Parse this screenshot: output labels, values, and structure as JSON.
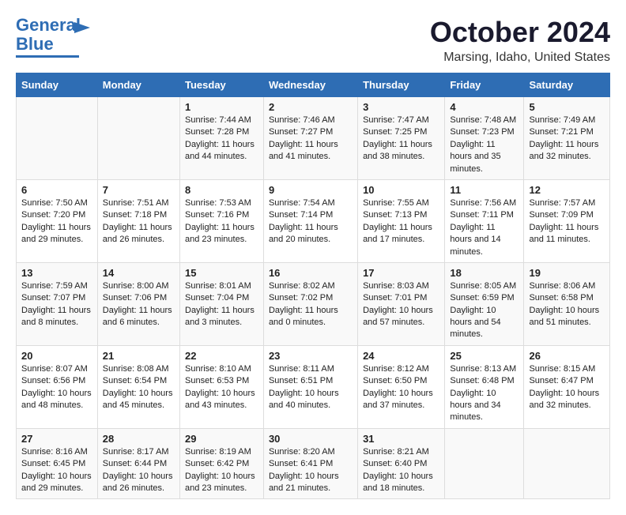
{
  "header": {
    "logo_line1": "General",
    "logo_line2": "Blue",
    "month": "October 2024",
    "location": "Marsing, Idaho, United States"
  },
  "weekdays": [
    "Sunday",
    "Monday",
    "Tuesday",
    "Wednesday",
    "Thursday",
    "Friday",
    "Saturday"
  ],
  "weeks": [
    [
      {
        "day": "",
        "sunrise": "",
        "sunset": "",
        "daylight": ""
      },
      {
        "day": "",
        "sunrise": "",
        "sunset": "",
        "daylight": ""
      },
      {
        "day": "1",
        "sunrise": "Sunrise: 7:44 AM",
        "sunset": "Sunset: 7:28 PM",
        "daylight": "Daylight: 11 hours and 44 minutes."
      },
      {
        "day": "2",
        "sunrise": "Sunrise: 7:46 AM",
        "sunset": "Sunset: 7:27 PM",
        "daylight": "Daylight: 11 hours and 41 minutes."
      },
      {
        "day": "3",
        "sunrise": "Sunrise: 7:47 AM",
        "sunset": "Sunset: 7:25 PM",
        "daylight": "Daylight: 11 hours and 38 minutes."
      },
      {
        "day": "4",
        "sunrise": "Sunrise: 7:48 AM",
        "sunset": "Sunset: 7:23 PM",
        "daylight": "Daylight: 11 hours and 35 minutes."
      },
      {
        "day": "5",
        "sunrise": "Sunrise: 7:49 AM",
        "sunset": "Sunset: 7:21 PM",
        "daylight": "Daylight: 11 hours and 32 minutes."
      }
    ],
    [
      {
        "day": "6",
        "sunrise": "Sunrise: 7:50 AM",
        "sunset": "Sunset: 7:20 PM",
        "daylight": "Daylight: 11 hours and 29 minutes."
      },
      {
        "day": "7",
        "sunrise": "Sunrise: 7:51 AM",
        "sunset": "Sunset: 7:18 PM",
        "daylight": "Daylight: 11 hours and 26 minutes."
      },
      {
        "day": "8",
        "sunrise": "Sunrise: 7:53 AM",
        "sunset": "Sunset: 7:16 PM",
        "daylight": "Daylight: 11 hours and 23 minutes."
      },
      {
        "day": "9",
        "sunrise": "Sunrise: 7:54 AM",
        "sunset": "Sunset: 7:14 PM",
        "daylight": "Daylight: 11 hours and 20 minutes."
      },
      {
        "day": "10",
        "sunrise": "Sunrise: 7:55 AM",
        "sunset": "Sunset: 7:13 PM",
        "daylight": "Daylight: 11 hours and 17 minutes."
      },
      {
        "day": "11",
        "sunrise": "Sunrise: 7:56 AM",
        "sunset": "Sunset: 7:11 PM",
        "daylight": "Daylight: 11 hours and 14 minutes."
      },
      {
        "day": "12",
        "sunrise": "Sunrise: 7:57 AM",
        "sunset": "Sunset: 7:09 PM",
        "daylight": "Daylight: 11 hours and 11 minutes."
      }
    ],
    [
      {
        "day": "13",
        "sunrise": "Sunrise: 7:59 AM",
        "sunset": "Sunset: 7:07 PM",
        "daylight": "Daylight: 11 hours and 8 minutes."
      },
      {
        "day": "14",
        "sunrise": "Sunrise: 8:00 AM",
        "sunset": "Sunset: 7:06 PM",
        "daylight": "Daylight: 11 hours and 6 minutes."
      },
      {
        "day": "15",
        "sunrise": "Sunrise: 8:01 AM",
        "sunset": "Sunset: 7:04 PM",
        "daylight": "Daylight: 11 hours and 3 minutes."
      },
      {
        "day": "16",
        "sunrise": "Sunrise: 8:02 AM",
        "sunset": "Sunset: 7:02 PM",
        "daylight": "Daylight: 11 hours and 0 minutes."
      },
      {
        "day": "17",
        "sunrise": "Sunrise: 8:03 AM",
        "sunset": "Sunset: 7:01 PM",
        "daylight": "Daylight: 10 hours and 57 minutes."
      },
      {
        "day": "18",
        "sunrise": "Sunrise: 8:05 AM",
        "sunset": "Sunset: 6:59 PM",
        "daylight": "Daylight: 10 hours and 54 minutes."
      },
      {
        "day": "19",
        "sunrise": "Sunrise: 8:06 AM",
        "sunset": "Sunset: 6:58 PM",
        "daylight": "Daylight: 10 hours and 51 minutes."
      }
    ],
    [
      {
        "day": "20",
        "sunrise": "Sunrise: 8:07 AM",
        "sunset": "Sunset: 6:56 PM",
        "daylight": "Daylight: 10 hours and 48 minutes."
      },
      {
        "day": "21",
        "sunrise": "Sunrise: 8:08 AM",
        "sunset": "Sunset: 6:54 PM",
        "daylight": "Daylight: 10 hours and 45 minutes."
      },
      {
        "day": "22",
        "sunrise": "Sunrise: 8:10 AM",
        "sunset": "Sunset: 6:53 PM",
        "daylight": "Daylight: 10 hours and 43 minutes."
      },
      {
        "day": "23",
        "sunrise": "Sunrise: 8:11 AM",
        "sunset": "Sunset: 6:51 PM",
        "daylight": "Daylight: 10 hours and 40 minutes."
      },
      {
        "day": "24",
        "sunrise": "Sunrise: 8:12 AM",
        "sunset": "Sunset: 6:50 PM",
        "daylight": "Daylight: 10 hours and 37 minutes."
      },
      {
        "day": "25",
        "sunrise": "Sunrise: 8:13 AM",
        "sunset": "Sunset: 6:48 PM",
        "daylight": "Daylight: 10 hours and 34 minutes."
      },
      {
        "day": "26",
        "sunrise": "Sunrise: 8:15 AM",
        "sunset": "Sunset: 6:47 PM",
        "daylight": "Daylight: 10 hours and 32 minutes."
      }
    ],
    [
      {
        "day": "27",
        "sunrise": "Sunrise: 8:16 AM",
        "sunset": "Sunset: 6:45 PM",
        "daylight": "Daylight: 10 hours and 29 minutes."
      },
      {
        "day": "28",
        "sunrise": "Sunrise: 8:17 AM",
        "sunset": "Sunset: 6:44 PM",
        "daylight": "Daylight: 10 hours and 26 minutes."
      },
      {
        "day": "29",
        "sunrise": "Sunrise: 8:19 AM",
        "sunset": "Sunset: 6:42 PM",
        "daylight": "Daylight: 10 hours and 23 minutes."
      },
      {
        "day": "30",
        "sunrise": "Sunrise: 8:20 AM",
        "sunset": "Sunset: 6:41 PM",
        "daylight": "Daylight: 10 hours and 21 minutes."
      },
      {
        "day": "31",
        "sunrise": "Sunrise: 8:21 AM",
        "sunset": "Sunset: 6:40 PM",
        "daylight": "Daylight: 10 hours and 18 minutes."
      },
      {
        "day": "",
        "sunrise": "",
        "sunset": "",
        "daylight": ""
      },
      {
        "day": "",
        "sunrise": "",
        "sunset": "",
        "daylight": ""
      }
    ]
  ]
}
